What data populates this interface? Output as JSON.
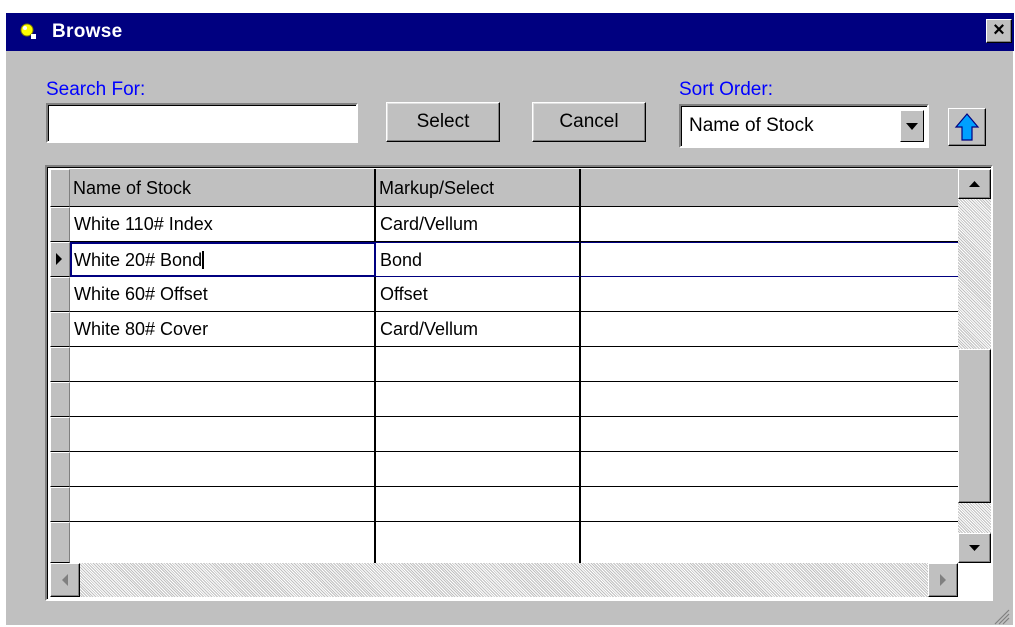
{
  "window": {
    "title": "Browse",
    "close_label": "×"
  },
  "search": {
    "label": "Search For:",
    "value": ""
  },
  "buttons": {
    "select_label": "Select",
    "cancel_label": "Cancel"
  },
  "sort": {
    "label": "Sort Order:",
    "selected": "Name of Stock"
  },
  "icons": {
    "app": "app-icon",
    "close": "close-icon",
    "dropdown": "chevron-down-icon",
    "sort_direction": "arrow-up-icon",
    "row_indicator": "current-row-indicator-icon",
    "resize_grip": "resize-grip-icon"
  },
  "table": {
    "columns": [
      "Name of Stock",
      "Markup/Select",
      ""
    ],
    "rows": [
      [
        "White 110# Index",
        "Card/Vellum"
      ],
      [
        "White 20# Bond",
        "Bond"
      ],
      [
        "White 60# Offset",
        "Offset"
      ],
      [
        "White 80# Cover",
        "Card/Vellum"
      ],
      [
        "",
        ""
      ],
      [
        "",
        ""
      ],
      [
        "",
        ""
      ],
      [
        "",
        ""
      ],
      [
        "",
        ""
      ],
      [
        "",
        ""
      ]
    ],
    "current_row": 2
  },
  "colors": {
    "title_bar": "#000080",
    "label_text": "#0000ff",
    "face": "#c0c0c0",
    "sort_arrow": "#00a0ff"
  }
}
